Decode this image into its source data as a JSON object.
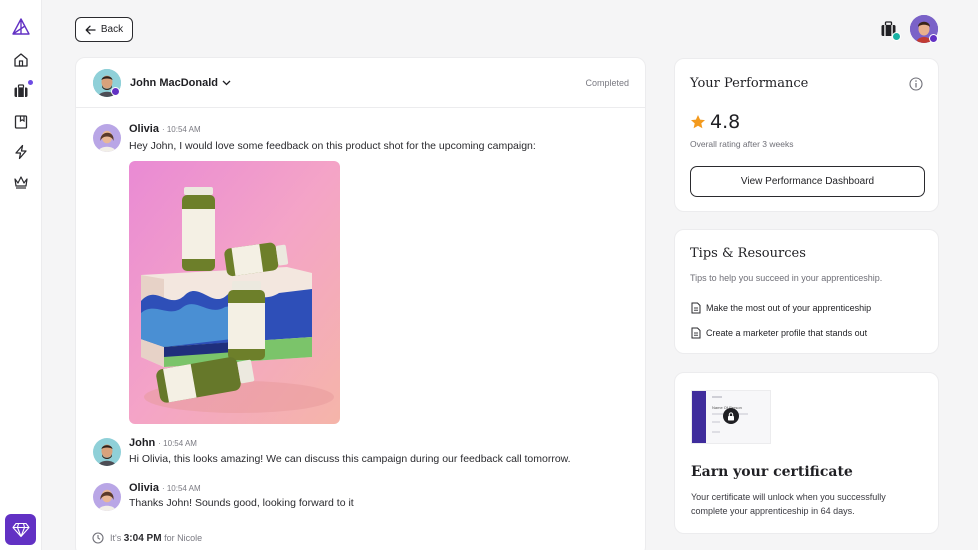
{
  "nav": {
    "back_label": "Back"
  },
  "chat": {
    "contact_name": "John MacDonald",
    "status": "Completed",
    "messages": [
      {
        "name": "Olivia",
        "time": "· 10:54 AM",
        "text": "Hey John, I would love some feedback on this product shot for the upcoming campaign:"
      },
      {
        "name": "John",
        "time": "· 10:54 AM",
        "text": "Hi Olivia, this looks amazing! We can discuss this campaign during our feedback call tomorrow."
      },
      {
        "name": "Olivia",
        "time": "· 10:54 AM",
        "text": "Thanks John! Sounds good, looking forward to it"
      }
    ],
    "footer": {
      "prefix": "It's",
      "time": "3:04 PM",
      "suffix": "for Nicole"
    }
  },
  "performance": {
    "title": "Your Performance",
    "rating": "4.8",
    "subtitle": "Overall rating after 3 weeks",
    "button_label": "View Performance Dashboard"
  },
  "tips": {
    "title": "Tips & Resources",
    "subtitle": "Tips to help you succeed in your apprenticeship.",
    "links": [
      {
        "label": "Make the most out of your apprenticeship"
      },
      {
        "label": "Create a marketer profile that stands out"
      }
    ]
  },
  "certificate": {
    "title": "Earn your certificate",
    "description_line1": "Your certificate will unlock when you successfully",
    "description_line2": "complete your apprenticeship in 64 days.",
    "preview_name": "Name Of Person"
  },
  "colors": {
    "accent_purple": "#6231c4",
    "notification_dot": "#6d4be3",
    "verified_teal": "#18b2a4",
    "star": "#f39a1e"
  }
}
